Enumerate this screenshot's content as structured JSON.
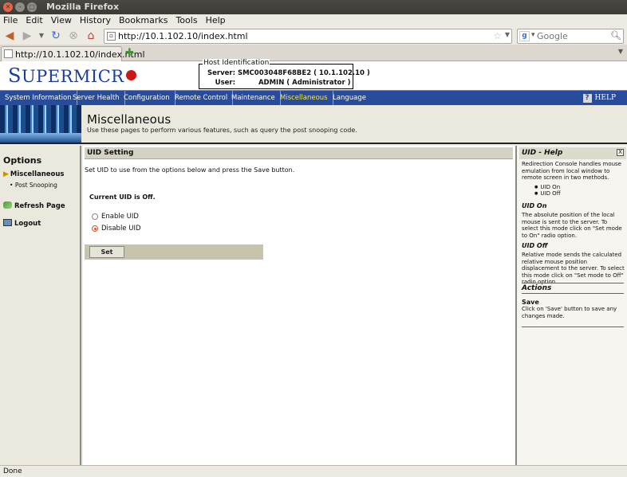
{
  "window": {
    "title": "Mozilla Firefox"
  },
  "menubar": [
    "File",
    "Edit",
    "View",
    "History",
    "Bookmarks",
    "Tools",
    "Help"
  ],
  "navbar": {
    "url": "http://10.1.102.10/index.html",
    "search_placeholder": "Google"
  },
  "tab": {
    "label": "http://10.1.102.10/index.html"
  },
  "header": {
    "logo_first": "S",
    "logo_rest": "UPERMICR",
    "host_legend": "Host Identification",
    "server_label": "Server:",
    "server_value": "SMC003048F68BE2 (    10.1.102.10    )",
    "user_label": "User:",
    "user_value": "ADMIN          ( Administrator )"
  },
  "mainnav": {
    "items": [
      "System Information",
      "Server Health",
      "Configuration",
      "Remote Control",
      "Maintenance",
      "Miscellaneous",
      "Language"
    ],
    "active_index": 5,
    "help": "HELP"
  },
  "banner": {
    "title": "Miscellaneous",
    "description": "Use these pages to perform various features, such as query the post snooping code."
  },
  "sidebar": {
    "title": "Options",
    "items": [
      "Miscellaneous",
      "Post Snooping",
      "Refresh Page",
      "Logout"
    ]
  },
  "content": {
    "section_title": "UID Setting",
    "intro": "Set UID to use from the options below and press the Save button.",
    "status": "Current UID is Off.",
    "option_enable": "Enable UID",
    "option_disable": "Disable UID",
    "selected": "Disable UID",
    "set_button": "Set"
  },
  "help": {
    "title": "UID - Help",
    "close": "X",
    "intro": "Redirection Console handles mouse emulation from local window to remote screen in two methods.",
    "bullets": [
      "UID On",
      "UID Off"
    ],
    "uid_on_title": "UID On",
    "uid_on_text": "The absolute position of the local mouse is sent to the server. To select this mode click on \"Set mode to On\" radio option.",
    "uid_off_title": "UID Off",
    "uid_off_text": "Relative mode sends the calculated relative mouse position displacement to the server. To select this mode click on \"Set mode to Off\" radio option.",
    "actions_title": "Actions",
    "save_title": "Save",
    "save_text": "Click on 'Save' button to save any changes made."
  },
  "statusbar": {
    "text": "Done"
  },
  "colors": {
    "nav_bg": "#284c9b",
    "nav_active": "#f4e64a",
    "logo": "#1b3d9b",
    "logo_dot": "#cc1717"
  }
}
